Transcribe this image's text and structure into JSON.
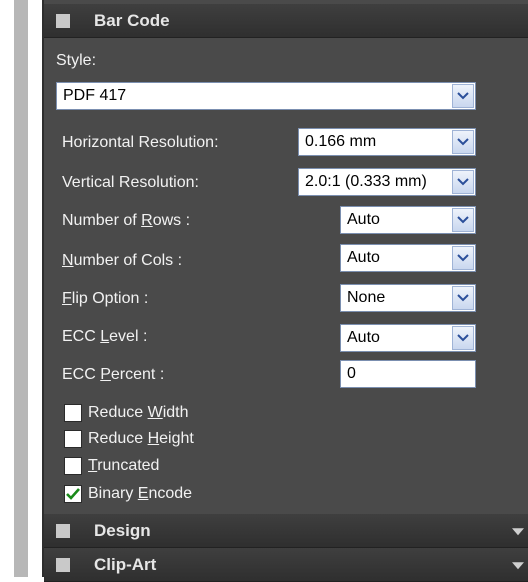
{
  "panel": {
    "bar_code_title": "Bar Code",
    "style_label": "Style:",
    "style_value": "PDF 417",
    "fields": [
      {
        "label": "Horizontal Resolution:",
        "value": "0.166 mm"
      },
      {
        "label": "Vertical Resolution:",
        "value": "2.0:1 (0.333 mm)"
      },
      {
        "label_pre": "Number of ",
        "label_u": "R",
        "label_post": "ows :",
        "value": "Auto"
      },
      {
        "label_pre": "",
        "label_u": "N",
        "label_post": "umber of Cols :",
        "value": "Auto"
      },
      {
        "label_pre": "",
        "label_u": "F",
        "label_post": "lip Option :",
        "value": "None"
      },
      {
        "label_pre": "ECC ",
        "label_u": "L",
        "label_post": "evel :",
        "value": "Auto"
      },
      {
        "label_pre": "ECC ",
        "label_u": "P",
        "label_post": "ercent :",
        "value": "0"
      }
    ],
    "checkboxes": [
      {
        "pre": "Reduce ",
        "u": "W",
        "post": "idth",
        "checked": false
      },
      {
        "pre": "Reduce ",
        "u": "H",
        "post": "eight",
        "checked": false
      },
      {
        "pre": "",
        "u": "T",
        "post": "runcated",
        "checked": false
      },
      {
        "pre": "Binary ",
        "u": "E",
        "post": "ncode",
        "checked": true
      }
    ],
    "design_title": "Design",
    "clipart_title": "Clip-Art"
  },
  "colors": {
    "panel_bg": "#4a4a4a",
    "header_bg": "#333333",
    "check": "#1a8a1a"
  }
}
